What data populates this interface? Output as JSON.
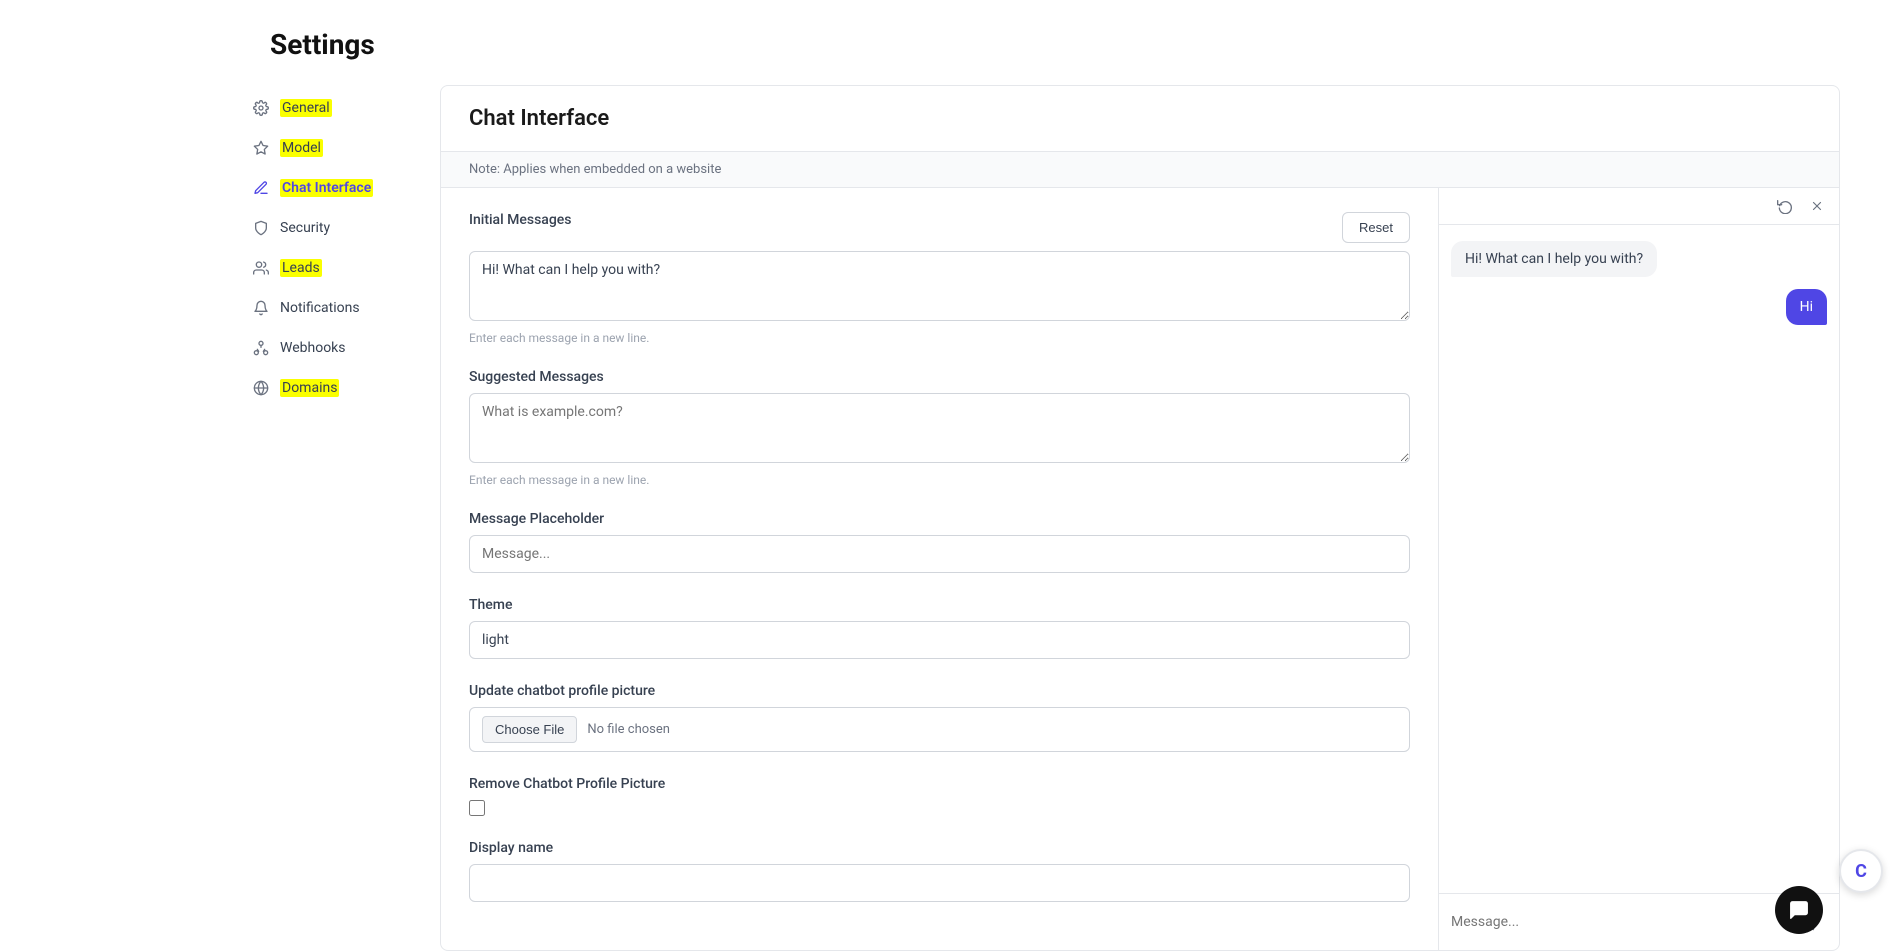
{
  "page": {
    "title": "Settings"
  },
  "sidebar": {
    "items": [
      {
        "id": "general",
        "label": "General",
        "icon": "gear",
        "highlight": true
      },
      {
        "id": "model",
        "label": "Model",
        "icon": "sparkle",
        "highlight": true
      },
      {
        "id": "chat-interface",
        "label": "Chat Interface",
        "icon": "pencil",
        "highlight": true,
        "active": true
      },
      {
        "id": "security",
        "label": "Security",
        "icon": "shield",
        "highlight": false
      },
      {
        "id": "leads",
        "label": "Leads",
        "icon": "users",
        "highlight": true
      },
      {
        "id": "notifications",
        "label": "Notifications",
        "icon": "bell",
        "highlight": false
      },
      {
        "id": "webhooks",
        "label": "Webhooks",
        "icon": "webhook",
        "highlight": false
      },
      {
        "id": "domains",
        "label": "Domains",
        "icon": "globe",
        "highlight": true
      }
    ]
  },
  "main": {
    "section_title": "Chat Interface",
    "note": "Note: Applies when embedded on a website",
    "fields": {
      "initial_messages": {
        "label": "Initial Messages",
        "value": "Hi! What can I help you with?",
        "hint": "Enter each message in a new line.",
        "reset_label": "Reset"
      },
      "suggested_messages": {
        "label": "Suggested Messages",
        "placeholder": "What is example.com?",
        "hint": "Enter each message in a new line."
      },
      "message_placeholder": {
        "label": "Message Placeholder",
        "placeholder": "Message..."
      },
      "theme": {
        "label": "Theme",
        "value": "light"
      },
      "update_profile_picture": {
        "label": "Update chatbot profile picture",
        "choose_file_label": "Choose File",
        "no_file_text": "No file chosen"
      },
      "remove_profile_picture": {
        "label": "Remove Chatbot Profile Picture"
      },
      "display_name": {
        "label": "Display name"
      }
    }
  },
  "chat_preview": {
    "bot_message": "Hi! What can I help you with?",
    "user_message": "Hi",
    "input_placeholder": "Message...",
    "refresh_icon": "↻",
    "close_icon": "✕",
    "send_icon": "➤"
  },
  "widget": {
    "icon": "💬"
  },
  "bottom_logo": "C"
}
